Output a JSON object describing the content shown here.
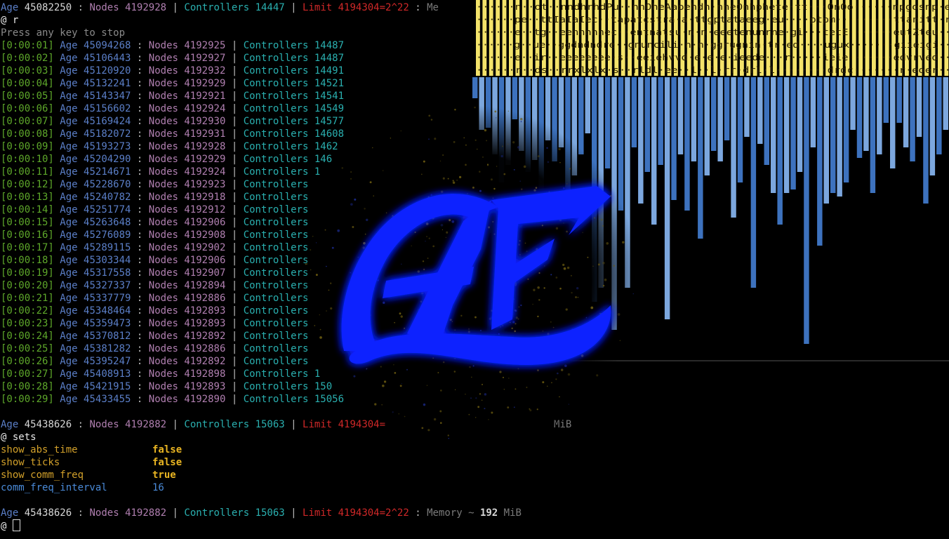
{
  "status_top": {
    "age_label": "Age",
    "age": "45082250",
    "nodes_label": "Nodes",
    "nodes": "4192928",
    "ctrl_label": "Controllers",
    "ctrl": "14447",
    "limit_text": "Limit 4194304=2^22",
    "mem_text": "Me"
  },
  "cmd1": "@ r",
  "press_any": "Press any key to stop",
  "ticks": [
    {
      "t": "[0:00:01]",
      "age": "45094268",
      "nodes": "4192925",
      "ctrl": "14487"
    },
    {
      "t": "[0:00:02]",
      "age": "45106443",
      "nodes": "4192927",
      "ctrl": "14487"
    },
    {
      "t": "[0:00:03]",
      "age": "45120920",
      "nodes": "4192932",
      "ctrl": "14491"
    },
    {
      "t": "[0:00:04]",
      "age": "45132241",
      "nodes": "4192929",
      "ctrl": "14521"
    },
    {
      "t": "[0:00:05]",
      "age": "45143347",
      "nodes": "4192921",
      "ctrl": "14541"
    },
    {
      "t": "[0:00:06]",
      "age": "45156602",
      "nodes": "4192924",
      "ctrl": "14549"
    },
    {
      "t": "[0:00:07]",
      "age": "45169424",
      "nodes": "4192930",
      "ctrl": "14577"
    },
    {
      "t": "[0:00:08]",
      "age": "45182072",
      "nodes": "4192931",
      "ctrl": "14608"
    },
    {
      "t": "[0:00:09]",
      "age": "45193273",
      "nodes": "4192928",
      "ctrl": "1462"
    },
    {
      "t": "[0:00:10]",
      "age": "45204290",
      "nodes": "4192929",
      "ctrl": "146"
    },
    {
      "t": "[0:00:11]",
      "age": "45214671",
      "nodes": "4192924",
      "ctrl": "1"
    },
    {
      "t": "[0:00:12]",
      "age": "45228670",
      "nodes": "4192923",
      "ctrl": ""
    },
    {
      "t": "[0:00:13]",
      "age": "45240782",
      "nodes": "4192918",
      "ctrl": ""
    },
    {
      "t": "[0:00:14]",
      "age": "45251774",
      "nodes": "4192912",
      "ctrl": ""
    },
    {
      "t": "[0:00:15]",
      "age": "45263648",
      "nodes": "4192906",
      "ctrl": ""
    },
    {
      "t": "[0:00:16]",
      "age": "45276089",
      "nodes": "4192908",
      "ctrl": ""
    },
    {
      "t": "[0:00:17]",
      "age": "45289115",
      "nodes": "4192902",
      "ctrl": ""
    },
    {
      "t": "[0:00:18]",
      "age": "45303344",
      "nodes": "4192906",
      "ctrl": ""
    },
    {
      "t": "[0:00:19]",
      "age": "45317558",
      "nodes": "4192907",
      "ctrl": ""
    },
    {
      "t": "[0:00:20]",
      "age": "45327337",
      "nodes": "4192894",
      "ctrl": ""
    },
    {
      "t": "[0:00:21]",
      "age": "45337779",
      "nodes": "4192886",
      "ctrl": ""
    },
    {
      "t": "[0:00:22]",
      "age": "45348464",
      "nodes": "4192893",
      "ctrl": ""
    },
    {
      "t": "[0:00:23]",
      "age": "45359473",
      "nodes": "4192893",
      "ctrl": ""
    },
    {
      "t": "[0:00:24]",
      "age": "45370812",
      "nodes": "4192892",
      "ctrl": ""
    },
    {
      "t": "[0:00:25]",
      "age": "45381282",
      "nodes": "4192886",
      "ctrl": ""
    },
    {
      "t": "[0:00:26]",
      "age": "45395247",
      "nodes": "4192892",
      "ctrl": ""
    },
    {
      "t": "[0:00:27]",
      "age": "45408913",
      "nodes": "4192898",
      "ctrl": "1"
    },
    {
      "t": "[0:00:28]",
      "age": "45421915",
      "nodes": "4192893",
      "ctrl": "150"
    },
    {
      "t": "[0:00:29]",
      "age": "45433455",
      "nodes": "4192890",
      "ctrl": "15056"
    }
  ],
  "status_mid": {
    "age": "45438626",
    "nodes": "4192882",
    "ctrl": "15063",
    "limit_text": "Limit 4194304=",
    "mem_text": "MiB"
  },
  "cmd2": "@ sets",
  "settings": [
    {
      "name": "show_abs_time",
      "value": "false",
      "kind": "bool",
      "color": "yellow"
    },
    {
      "name": "show_ticks",
      "value": "false",
      "kind": "bool",
      "color": "yellow"
    },
    {
      "name": "show_comm_freq",
      "value": "true",
      "kind": "bool",
      "color": "yellow"
    },
    {
      "name": "comm_freq_interval",
      "value": "16",
      "kind": "int",
      "color": "blue"
    }
  ],
  "status_bottom": {
    "age": "45438626",
    "nodes": "4192882",
    "ctrl": "15063",
    "limit_text": "Limit 4194304=2^22",
    "mem_label": "Memory ~",
    "mem_value": "192",
    "mem_unit": "MiB"
  },
  "prompt": "@",
  "grid_rows": [
    "······n··ot··nndhrhdPu··nhOheAapehdh·nneOnhphete·tt···OnOo······npgosnp·e",
    "······pe··ttIaIaIec··tapatcstra·a·ttgptataeeg·eu····ptpm·········ttanitt·r",
    "······e··tg··eennnnnec··entnatsu·n·n·eeetenunrne·gi···tetE·······eutZteu··",
    "······g··ue··ggdndndre··gnuncili·n·n·ggrugnin·tr·ed····ugux·······giieigi··",
    "······e··ir··eeeeeeee·s··eeiehvvd·e·e·e·ieede···r·····ieie·······edvrved··",
    "······r··ds··rrxlxlx·s··rldl·ee··l··l·rr·drl·l········drdc·······r·eoer··"
  ],
  "colors": {
    "grid_yellow": "#f4e36a",
    "bar_dark": "#3d72be",
    "bar_light": "#7ca7de",
    "logo_blue": "#0a22ff"
  },
  "logo_text": "AE"
}
